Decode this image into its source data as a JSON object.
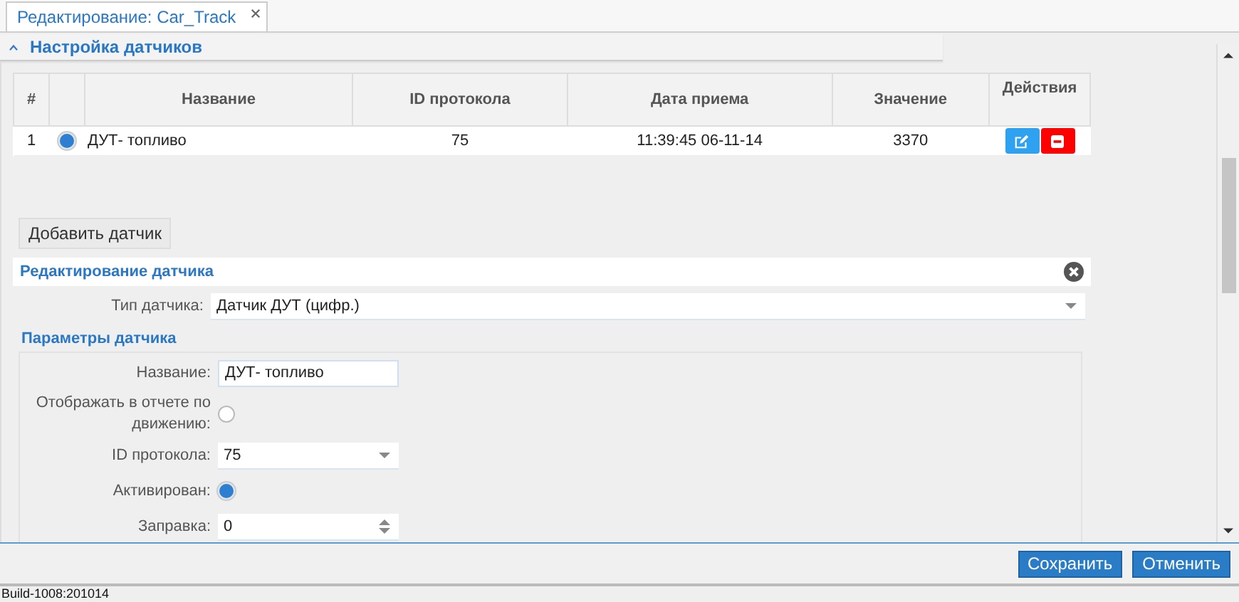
{
  "tab": {
    "label": "Редактирование: Car_Track",
    "closable": true
  },
  "section": {
    "title": "Настройка датчиков",
    "expanded": true
  },
  "table": {
    "columns": [
      "#",
      "",
      "Название",
      "ID протокола",
      "Дата приема",
      "Значение"
    ],
    "actions_title": "Действия",
    "rows": [
      {
        "num": "1",
        "selected": true,
        "name": "ДУТ- топливо",
        "protocol_id": "75",
        "date": "11:39:45 06-11-14",
        "value": "3370"
      }
    ]
  },
  "add_button": "Добавить датчик",
  "edit_panel": {
    "title": "Редактирование датчика",
    "type_label": "Тип датчика:",
    "type_value": "Датчик ДУТ (цифр.)",
    "params_title": "Параметры датчика",
    "fields": [
      {
        "kind": "text",
        "label": "Название:",
        "value": "ДУТ- топливо"
      },
      {
        "kind": "radio",
        "label": "Отображать в отчете по движению:",
        "checked": false
      },
      {
        "kind": "select",
        "label": "ID протокола:",
        "value": "75"
      },
      {
        "kind": "radio",
        "label": "Активирован:",
        "checked": true
      },
      {
        "kind": "spin",
        "label": "Заправка:",
        "value": "0"
      }
    ]
  },
  "buttons": [
    "Сохранить",
    "Отменить"
  ],
  "build": "Build-1008:201014"
}
